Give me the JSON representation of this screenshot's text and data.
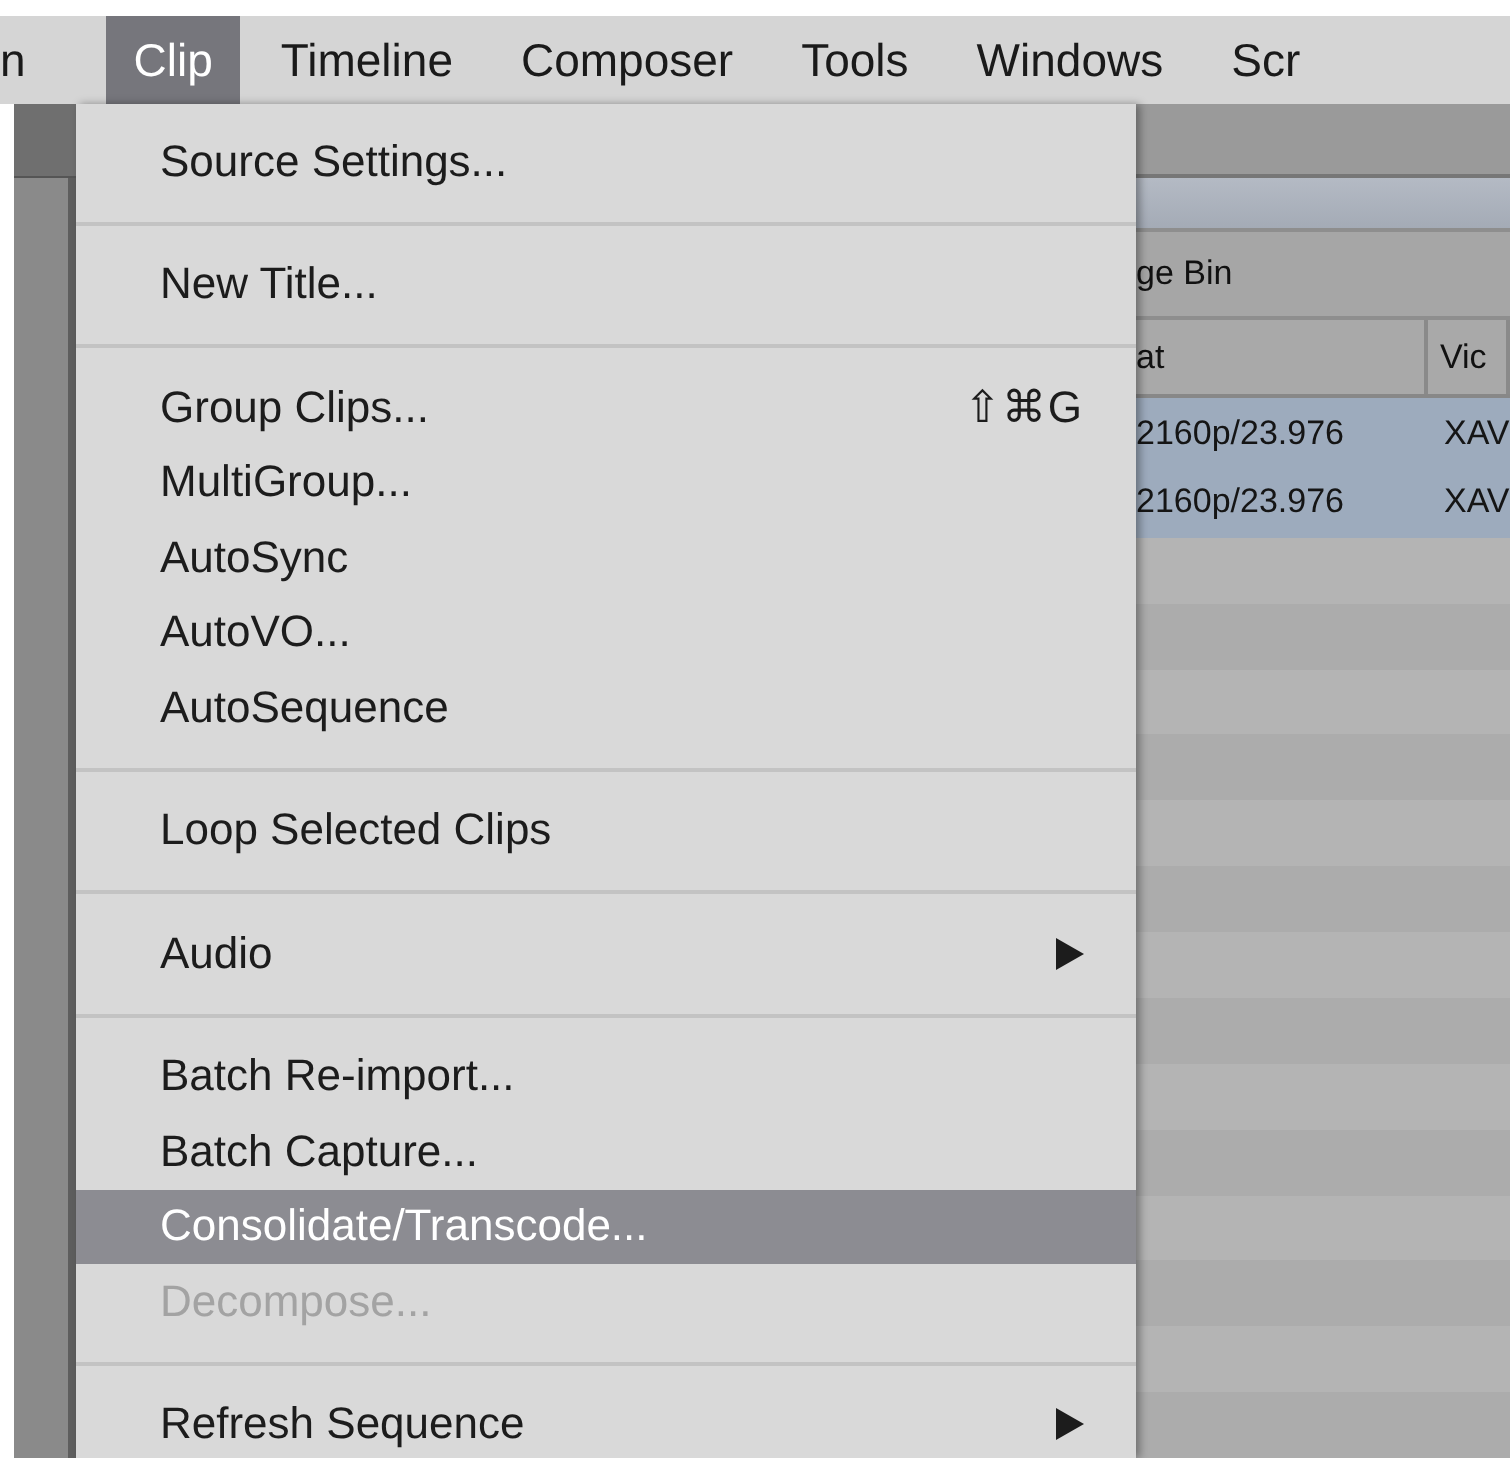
{
  "menu_bar": [
    {
      "label": "n",
      "selected": false
    },
    {
      "label": "Clip",
      "selected": true
    },
    {
      "label": "Timeline",
      "selected": false
    },
    {
      "label": "Composer",
      "selected": false
    },
    {
      "label": "Tools",
      "selected": false
    },
    {
      "label": "Windows",
      "selected": false
    },
    {
      "label": "Scr",
      "selected": false
    }
  ],
  "menu": {
    "sections": [
      [
        {
          "label": "Source Settings...",
          "highlighted": false,
          "disabled": false,
          "submenu": false
        }
      ],
      [
        {
          "label": "New Title...",
          "highlighted": false,
          "disabled": false,
          "submenu": false
        }
      ],
      [
        {
          "label": "Group Clips...",
          "shortcut": "⇧⌘G",
          "highlighted": false,
          "disabled": false,
          "submenu": false
        },
        {
          "label": "MultiGroup...",
          "highlighted": false,
          "disabled": false,
          "submenu": false
        },
        {
          "label": "AutoSync",
          "highlighted": false,
          "disabled": false,
          "submenu": false
        },
        {
          "label": "AutoVO...",
          "highlighted": false,
          "disabled": false,
          "submenu": false
        },
        {
          "label": "AutoSequence",
          "highlighted": false,
          "disabled": false,
          "submenu": false
        }
      ],
      [
        {
          "label": "Loop Selected Clips",
          "highlighted": false,
          "disabled": false,
          "submenu": false
        }
      ],
      [
        {
          "label": "Audio",
          "highlighted": false,
          "disabled": false,
          "submenu": true
        }
      ],
      [
        {
          "label": "Batch Re-import...",
          "highlighted": false,
          "disabled": false,
          "submenu": false
        },
        {
          "label": "Batch Capture...",
          "highlighted": false,
          "disabled": false,
          "submenu": false
        },
        {
          "label": "Consolidate/Transcode...",
          "highlighted": true,
          "disabled": false,
          "submenu": false
        },
        {
          "label": "Decompose...",
          "highlighted": false,
          "disabled": true,
          "submenu": false
        }
      ],
      [
        {
          "label": "Refresh Sequence",
          "highlighted": false,
          "disabled": false,
          "submenu": true
        }
      ]
    ]
  },
  "bin": {
    "title": "ge Bin",
    "columns": [
      "at",
      "Vic"
    ],
    "rows": [
      {
        "column_1": "2160p/23.976",
        "column_2": "XAV",
        "selected": true
      },
      {
        "column_1": "2160p/23.976",
        "column_2": "XAV",
        "selected": true
      }
    ]
  }
}
